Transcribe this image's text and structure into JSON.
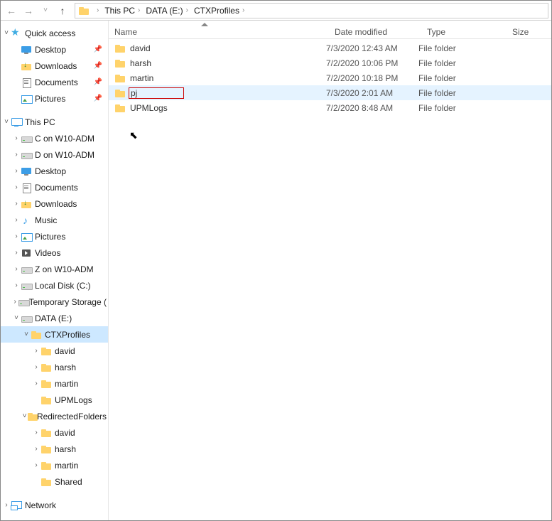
{
  "address": {
    "icon": "folder",
    "crumbs": [
      "This PC",
      "DATA (E:)",
      "CTXProfiles"
    ]
  },
  "columns": {
    "name": "Name",
    "date": "Date modified",
    "type": "Type",
    "size": "Size"
  },
  "rows": [
    {
      "name": "david",
      "date": "7/3/2020 12:43 AM",
      "type": "File folder",
      "selected": false,
      "highlight": false
    },
    {
      "name": "harsh",
      "date": "7/2/2020 10:06 PM",
      "type": "File folder",
      "selected": false,
      "highlight": false
    },
    {
      "name": "martin",
      "date": "7/2/2020 10:18 PM",
      "type": "File folder",
      "selected": false,
      "highlight": false
    },
    {
      "name": "pj",
      "date": "7/3/2020 2:01 AM",
      "type": "File folder",
      "selected": true,
      "highlight": true
    },
    {
      "name": "UPMLogs",
      "date": "7/2/2020 8:48 AM",
      "type": "File folder",
      "selected": false,
      "highlight": false
    }
  ],
  "nav": [
    {
      "type": "item",
      "indent": 0,
      "twist": "v",
      "icon": "star",
      "label": "Quick access"
    },
    {
      "type": "item",
      "indent": 1,
      "twist": "",
      "icon": "desktop",
      "label": "Desktop",
      "pin": true
    },
    {
      "type": "item",
      "indent": 1,
      "twist": "",
      "icon": "downloads",
      "label": "Downloads",
      "pin": true
    },
    {
      "type": "item",
      "indent": 1,
      "twist": "",
      "icon": "documents",
      "label": "Documents",
      "pin": true
    },
    {
      "type": "item",
      "indent": 1,
      "twist": "",
      "icon": "pictures",
      "label": "Pictures",
      "pin": true
    },
    {
      "type": "spacer"
    },
    {
      "type": "item",
      "indent": 0,
      "twist": "v",
      "icon": "pc",
      "label": "This PC"
    },
    {
      "type": "item",
      "indent": 1,
      "twist": ">",
      "icon": "drive",
      "label": "C on W10-ADM"
    },
    {
      "type": "item",
      "indent": 1,
      "twist": ">",
      "icon": "drive",
      "label": "D on W10-ADM"
    },
    {
      "type": "item",
      "indent": 1,
      "twist": ">",
      "icon": "desktop",
      "label": "Desktop"
    },
    {
      "type": "item",
      "indent": 1,
      "twist": ">",
      "icon": "documents",
      "label": "Documents"
    },
    {
      "type": "item",
      "indent": 1,
      "twist": ">",
      "icon": "downloads",
      "label": "Downloads"
    },
    {
      "type": "item",
      "indent": 1,
      "twist": ">",
      "icon": "music",
      "label": "Music"
    },
    {
      "type": "item",
      "indent": 1,
      "twist": ">",
      "icon": "pictures",
      "label": "Pictures"
    },
    {
      "type": "item",
      "indent": 1,
      "twist": ">",
      "icon": "videos",
      "label": "Videos"
    },
    {
      "type": "item",
      "indent": 1,
      "twist": ">",
      "icon": "drive",
      "label": "Z on W10-ADM"
    },
    {
      "type": "item",
      "indent": 1,
      "twist": ">",
      "icon": "drive",
      "label": "Local Disk (C:)"
    },
    {
      "type": "item",
      "indent": 1,
      "twist": ">",
      "icon": "drive",
      "label": "Temporary Storage ("
    },
    {
      "type": "item",
      "indent": 1,
      "twist": "v",
      "icon": "drive",
      "label": "DATA (E:)"
    },
    {
      "type": "item",
      "indent": 2,
      "twist": "v",
      "icon": "folder",
      "label": "CTXProfiles",
      "selected": true
    },
    {
      "type": "item",
      "indent": 3,
      "twist": ">",
      "icon": "folder",
      "label": "david"
    },
    {
      "type": "item",
      "indent": 3,
      "twist": ">",
      "icon": "folder",
      "label": "harsh"
    },
    {
      "type": "item",
      "indent": 3,
      "twist": ">",
      "icon": "folder",
      "label": "martin"
    },
    {
      "type": "item",
      "indent": 3,
      "twist": "",
      "icon": "folder",
      "label": "UPMLogs"
    },
    {
      "type": "item",
      "indent": 2,
      "twist": "v",
      "icon": "folder",
      "label": "RedirectedFolders"
    },
    {
      "type": "item",
      "indent": 3,
      "twist": ">",
      "icon": "folder",
      "label": "david"
    },
    {
      "type": "item",
      "indent": 3,
      "twist": ">",
      "icon": "folder",
      "label": "harsh"
    },
    {
      "type": "item",
      "indent": 3,
      "twist": ">",
      "icon": "folder",
      "label": "martin"
    },
    {
      "type": "item",
      "indent": 3,
      "twist": "",
      "icon": "folder",
      "label": "Shared"
    },
    {
      "type": "spacer"
    },
    {
      "type": "item",
      "indent": 0,
      "twist": ">",
      "icon": "net",
      "label": "Network"
    }
  ]
}
